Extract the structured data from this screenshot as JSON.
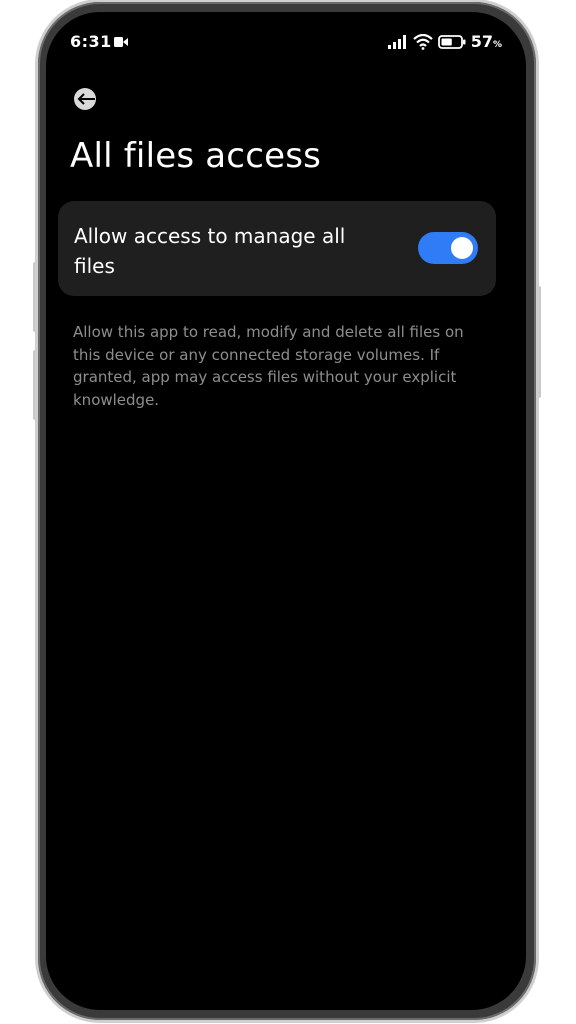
{
  "status_bar": {
    "time": "6:31",
    "battery_percent": "57",
    "battery_unit": "%",
    "battery_level": 0.57,
    "icons": [
      "screen-record-icon",
      "signal-icon",
      "wifi-icon",
      "battery-icon"
    ]
  },
  "header": {
    "back_icon": "back-arrow-icon",
    "title": "All files access"
  },
  "setting": {
    "label": "Allow access to manage all files",
    "toggle_state": "on",
    "toggle_color": "#2f7cf6"
  },
  "description": "Allow this app to read, modify and delete all files on this device or any connected storage volumes. If granted, app may access files without your explicit knowledge.",
  "colors": {
    "background": "#000000",
    "card": "#1f1f1f",
    "text_primary": "#ffffff",
    "text_secondary": "#8e8e8e",
    "accent": "#2f7cf6"
  }
}
